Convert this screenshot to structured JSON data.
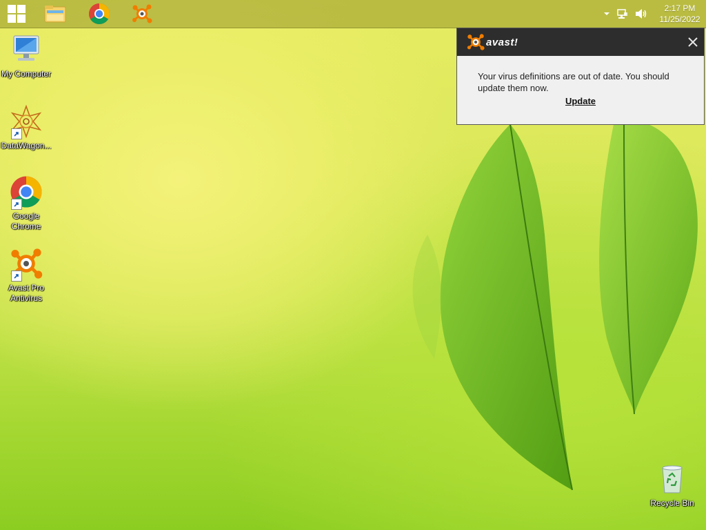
{
  "taskbar": {
    "pinned": [
      {
        "name": "file-explorer"
      },
      {
        "name": "google-chrome"
      },
      {
        "name": "avast"
      }
    ],
    "clock": {
      "time": "2:17 PM",
      "date": "11/25/2022"
    }
  },
  "desktop": {
    "icons": [
      {
        "label": "My Computer"
      },
      {
        "label": "DataWagon..."
      },
      {
        "label": "Google Chrome"
      },
      {
        "label": "Avast Pro Antivirus"
      },
      {
        "label": "Recycle Bin"
      }
    ]
  },
  "notification": {
    "brand": "avast!",
    "message": "Your virus definitions are out of date. You should update them now.",
    "action": "Update"
  },
  "colors": {
    "taskbar": "#96962a",
    "notify_header": "#2d2d2d",
    "avast_orange": "#f07d00"
  }
}
